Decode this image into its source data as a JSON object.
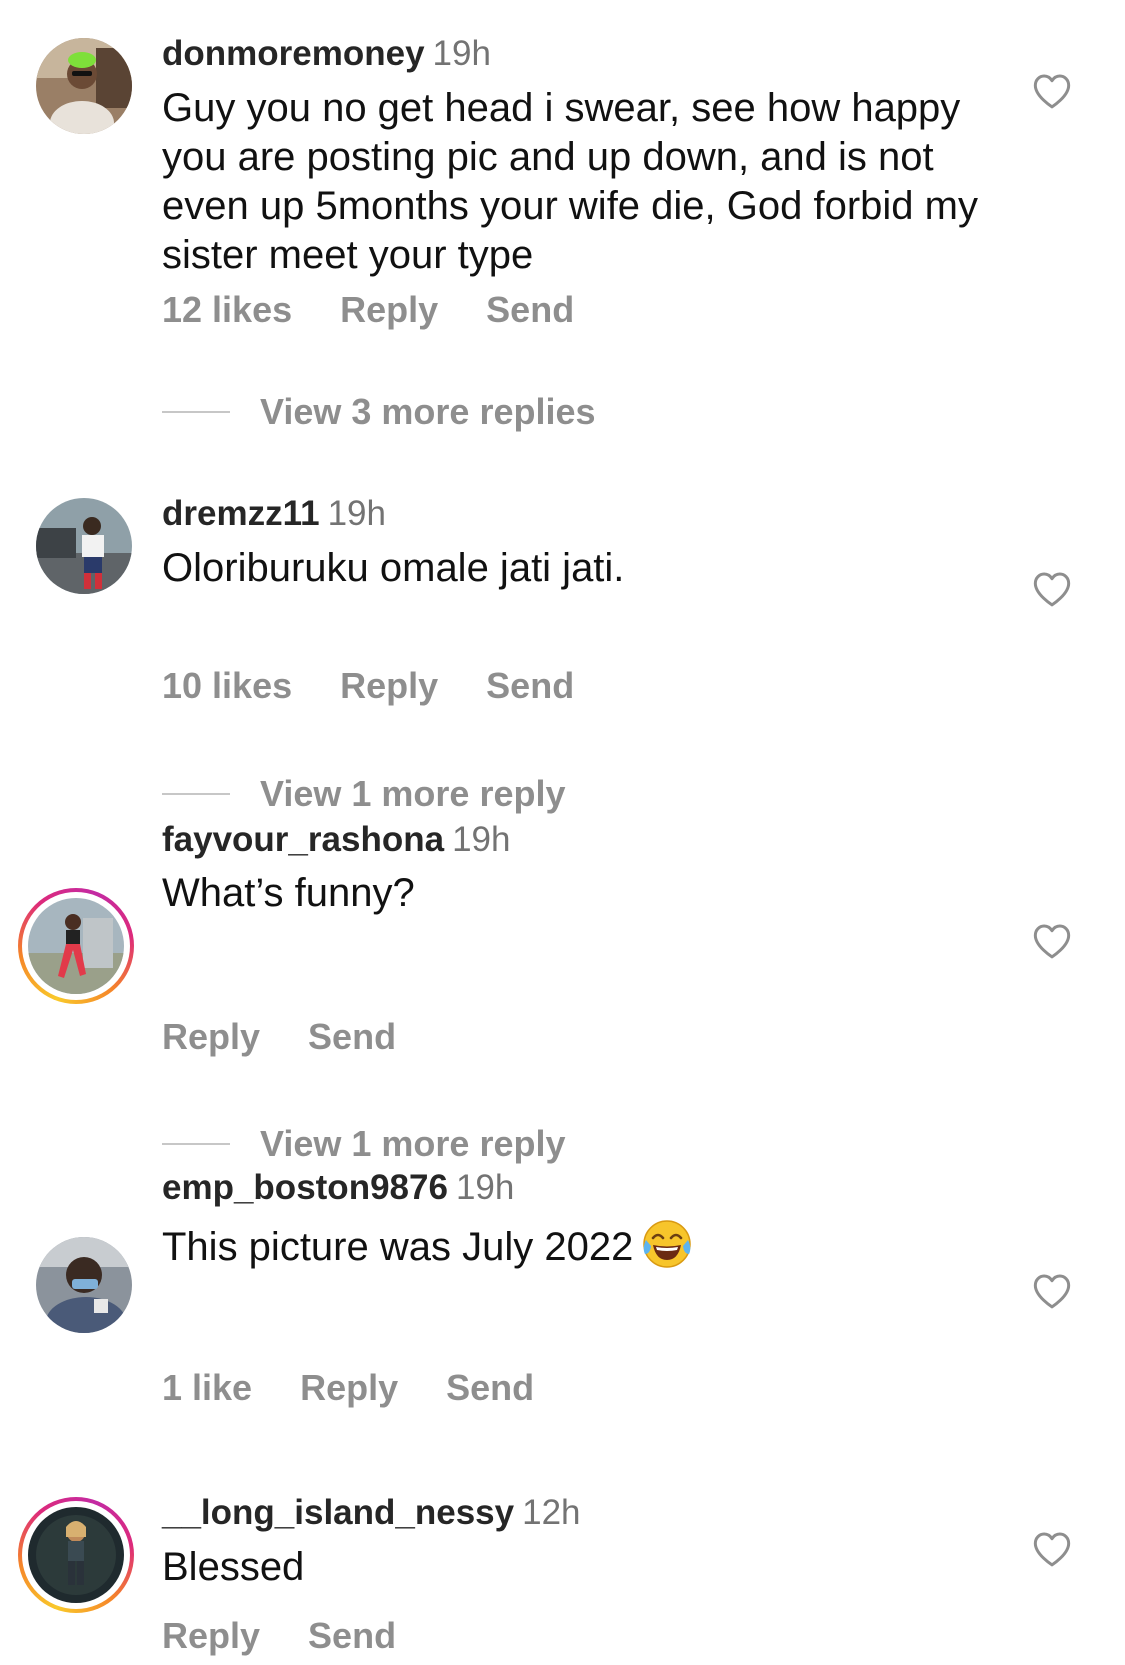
{
  "comments": [
    {
      "username": "donmoremoney",
      "time": "19h",
      "text": "Guy you no get head i swear, see how happy you are posting pic and up down, and is not even up 5months your wife die, God forbid my sister meet your type",
      "likes": "12 likes",
      "reply": "Reply",
      "send": "Send",
      "view_replies": "View 3 more replies",
      "avatar_icon": "profile-photo"
    },
    {
      "username": "dremzz11",
      "time": "19h",
      "text": "Oloriburuku omale jati jati.",
      "likes": "10 likes",
      "reply": "Reply",
      "send": "Send",
      "view_replies": "View 1 more reply",
      "avatar_icon": "profile-photo"
    },
    {
      "username": "fayvour_rashona",
      "time": "19h",
      "text": "What’s funny?",
      "reply": "Reply",
      "send": "Send",
      "view_replies": "View 1 more reply",
      "avatar_icon": "profile-photo-story-ring"
    },
    {
      "username": "emp_boston9876",
      "time": "19h",
      "text": "This picture was July 2022",
      "emoji": "face-with-tears-of-joy",
      "likes": "1 like",
      "reply": "Reply",
      "send": "Send",
      "avatar_icon": "profile-photo"
    },
    {
      "username": "__long_island_nessy",
      "time": "12h",
      "text": "Blessed",
      "reply": "Reply",
      "send": "Send",
      "avatar_icon": "profile-photo-story-ring"
    }
  ],
  "colors": {
    "text": "#111111",
    "secondary": "#8e8e8e",
    "username": "#262626",
    "ring_start": "#f9c92b",
    "ring_end": "#c32aa3"
  },
  "icons": {
    "like": "heart-outline-icon"
  }
}
